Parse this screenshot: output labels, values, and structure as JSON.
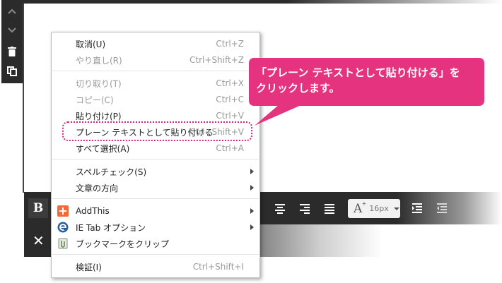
{
  "colors": {
    "accent": "#e6337f",
    "toolbar": "#2b2b2b",
    "menu_text": "#222222",
    "menu_disabled": "#9a9a9a"
  },
  "left_toolbar": {
    "icons": [
      "chevron-up-icon",
      "chevron-down-icon",
      "trash-icon",
      "copy-icon"
    ]
  },
  "format_bar": {
    "bold_label": "B",
    "font_size_glyph": "A",
    "font_size_value": "16px",
    "icons": [
      "align-center-icon",
      "align-right-icon",
      "align-justify-icon",
      "indent-icon",
      "outdent-icon"
    ]
  },
  "bottom_bar": {
    "close_glyph": "✕"
  },
  "context_menu": {
    "undo": {
      "label": "取消(U)",
      "shortcut": "Ctrl+Z"
    },
    "redo": {
      "label": "やり直し(R)",
      "shortcut": "Ctrl+Shift+Z"
    },
    "cut": {
      "label": "切り取り(T)",
      "shortcut": "Ctrl+X"
    },
    "copy": {
      "label": "コピー(C)",
      "shortcut": "Ctrl+C"
    },
    "paste": {
      "label": "貼り付け(P)",
      "shortcut": "Ctrl+V"
    },
    "paste_plain": {
      "label": "プレーン テキストとして貼り付ける",
      "shortcut": "Ctrl+Shift+V"
    },
    "select_all": {
      "label": "すべて選択(A)",
      "shortcut": "Ctrl+A"
    },
    "spellcheck": {
      "label": "スペルチェック(S)"
    },
    "writing_direction": {
      "label": "文章の方向"
    },
    "addthis": {
      "label": "AddThis",
      "icon": "addthis-icon"
    },
    "ie_tab": {
      "label": "IE Tab オプション",
      "icon": "ie-tab-icon"
    },
    "bookmark_clip": {
      "label": "ブックマークをクリップ",
      "icon": "clip-icon"
    },
    "inspect": {
      "label": "検証(I)",
      "shortcut": "Ctrl+Shift+I"
    }
  },
  "callout": {
    "line1": "「プレーン テキストとして貼り付ける」を",
    "line2": "クリックします。"
  }
}
